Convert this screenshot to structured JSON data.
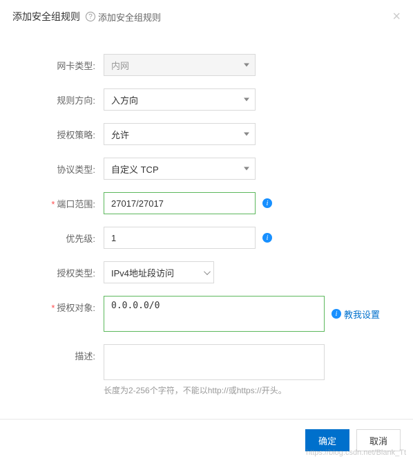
{
  "header": {
    "title": "添加安全组规则",
    "subtitle": "添加安全组规则"
  },
  "form": {
    "nic_type": {
      "label": "网卡类型:",
      "value": "内网"
    },
    "direction": {
      "label": "规则方向:",
      "value": "入方向"
    },
    "policy": {
      "label": "授权策略:",
      "value": "允许"
    },
    "protocol": {
      "label": "协议类型:",
      "value": "自定义 TCP"
    },
    "port_range": {
      "label": "端口范围:",
      "value": "27017/27017"
    },
    "priority": {
      "label": "优先级:",
      "value": "1"
    },
    "auth_type": {
      "label": "授权类型:",
      "value": "IPv4地址段访问"
    },
    "auth_object": {
      "label": "授权对象:",
      "value": "0.0.0.0/0",
      "help_link": "教我设置"
    },
    "description": {
      "label": "描述:",
      "value": "",
      "hint": "长度为2-256个字符，不能以http://或https://开头。"
    }
  },
  "footer": {
    "confirm": "确定",
    "cancel": "取消"
  },
  "watermark": "https://blog.csdn.net/Blank_Tt"
}
